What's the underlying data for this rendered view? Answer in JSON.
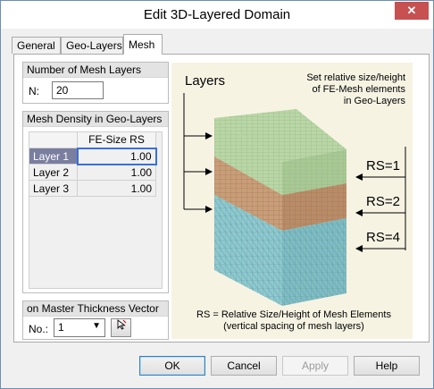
{
  "window": {
    "title": "Edit 3D-Layered Domain",
    "close_glyph": "✕"
  },
  "tabs": [
    {
      "label": "General",
      "active": false
    },
    {
      "label": "Geo-Layers",
      "active": false
    },
    {
      "label": "Mesh",
      "active": true
    }
  ],
  "mesh_layers": {
    "header": "Number of Mesh Layers",
    "n_label": "N:",
    "n_value": "20"
  },
  "mesh_density": {
    "header": "Mesh Density in Geo-Layers",
    "column_header": "FE-Size RS",
    "rows": [
      {
        "label": "Layer 1",
        "value": "1.00",
        "selected": true
      },
      {
        "label": "Layer 2",
        "value": "1.00",
        "selected": false
      },
      {
        "label": "Layer 3",
        "value": "1.00",
        "selected": false
      }
    ]
  },
  "master_thickness": {
    "header": "on Master Thickness Vector",
    "no_label": "No.:",
    "selected": "1"
  },
  "figure": {
    "title": "Layers",
    "note_lines": [
      "Set relative size/height",
      "of FE-Mesh elements",
      "in Geo-Layers"
    ],
    "rs_labels": [
      "RS=1",
      "RS=2",
      "RS=4"
    ],
    "caption_lines": [
      "RS = Relative Size/Height of Mesh Elements",
      "(vertical spacing of mesh layers)"
    ],
    "colors": {
      "top": "#b9d6a6",
      "middle": "#c89d78",
      "bottom": "#8fc9cf",
      "background": "#f7f3e3"
    }
  },
  "buttons": {
    "ok": "OK",
    "cancel": "Cancel",
    "apply": "Apply",
    "help": "Help"
  }
}
